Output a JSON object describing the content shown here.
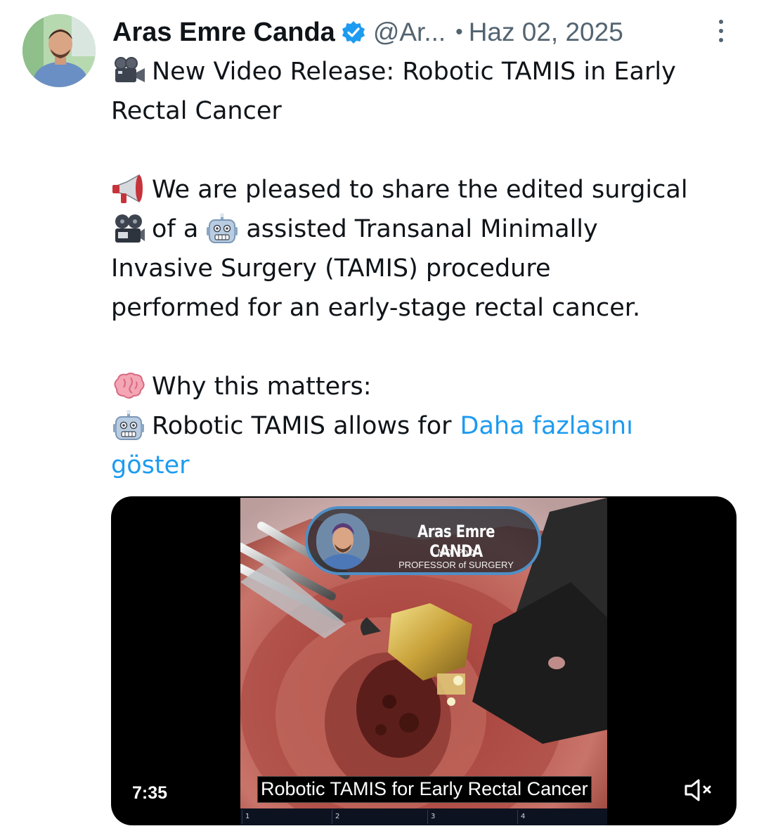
{
  "tweet": {
    "author_name": "Aras Emre Canda",
    "handle": "@Ar...",
    "separator": "•",
    "date": "Haz 02, 2025",
    "lines": [
      "New Video Release: Robotic TAMIS in Early",
      "Rectal Cancer",
      "We are pleased to share the edited surgical",
      "of a",
      "assisted Transanal Minimally",
      "Invasive Surgery (TAMIS) procedure",
      "performed for an early-stage rectal cancer.",
      "Why this matters:",
      "Robotic TAMIS allows for"
    ],
    "show_more_part1": "Daha fazlasını",
    "show_more_part2": "göster"
  },
  "video": {
    "duration": "7:35",
    "overlay_name": "Aras Emre CANDA",
    "overlay_degree": "MD, PhD",
    "overlay_title": "PROFESSOR of SURGERY",
    "caption": "Robotic TAMIS for Early Rectal Cancer",
    "hud_slots": [
      "1",
      "2",
      "3",
      "4"
    ]
  },
  "icons": {
    "verified": "verified-badge-icon",
    "more": "more-options-icon",
    "mute": "mute-icon",
    "emoji_camera": "movie-camera-emoji",
    "emoji_megaphone": "megaphone-emoji",
    "emoji_projector": "film-projector-emoji",
    "emoji_robot": "robot-emoji",
    "emoji_brain": "brain-emoji"
  },
  "colors": {
    "link": "#1d9bf0",
    "secondary": "#536471",
    "verified": "#1d9bf0"
  }
}
